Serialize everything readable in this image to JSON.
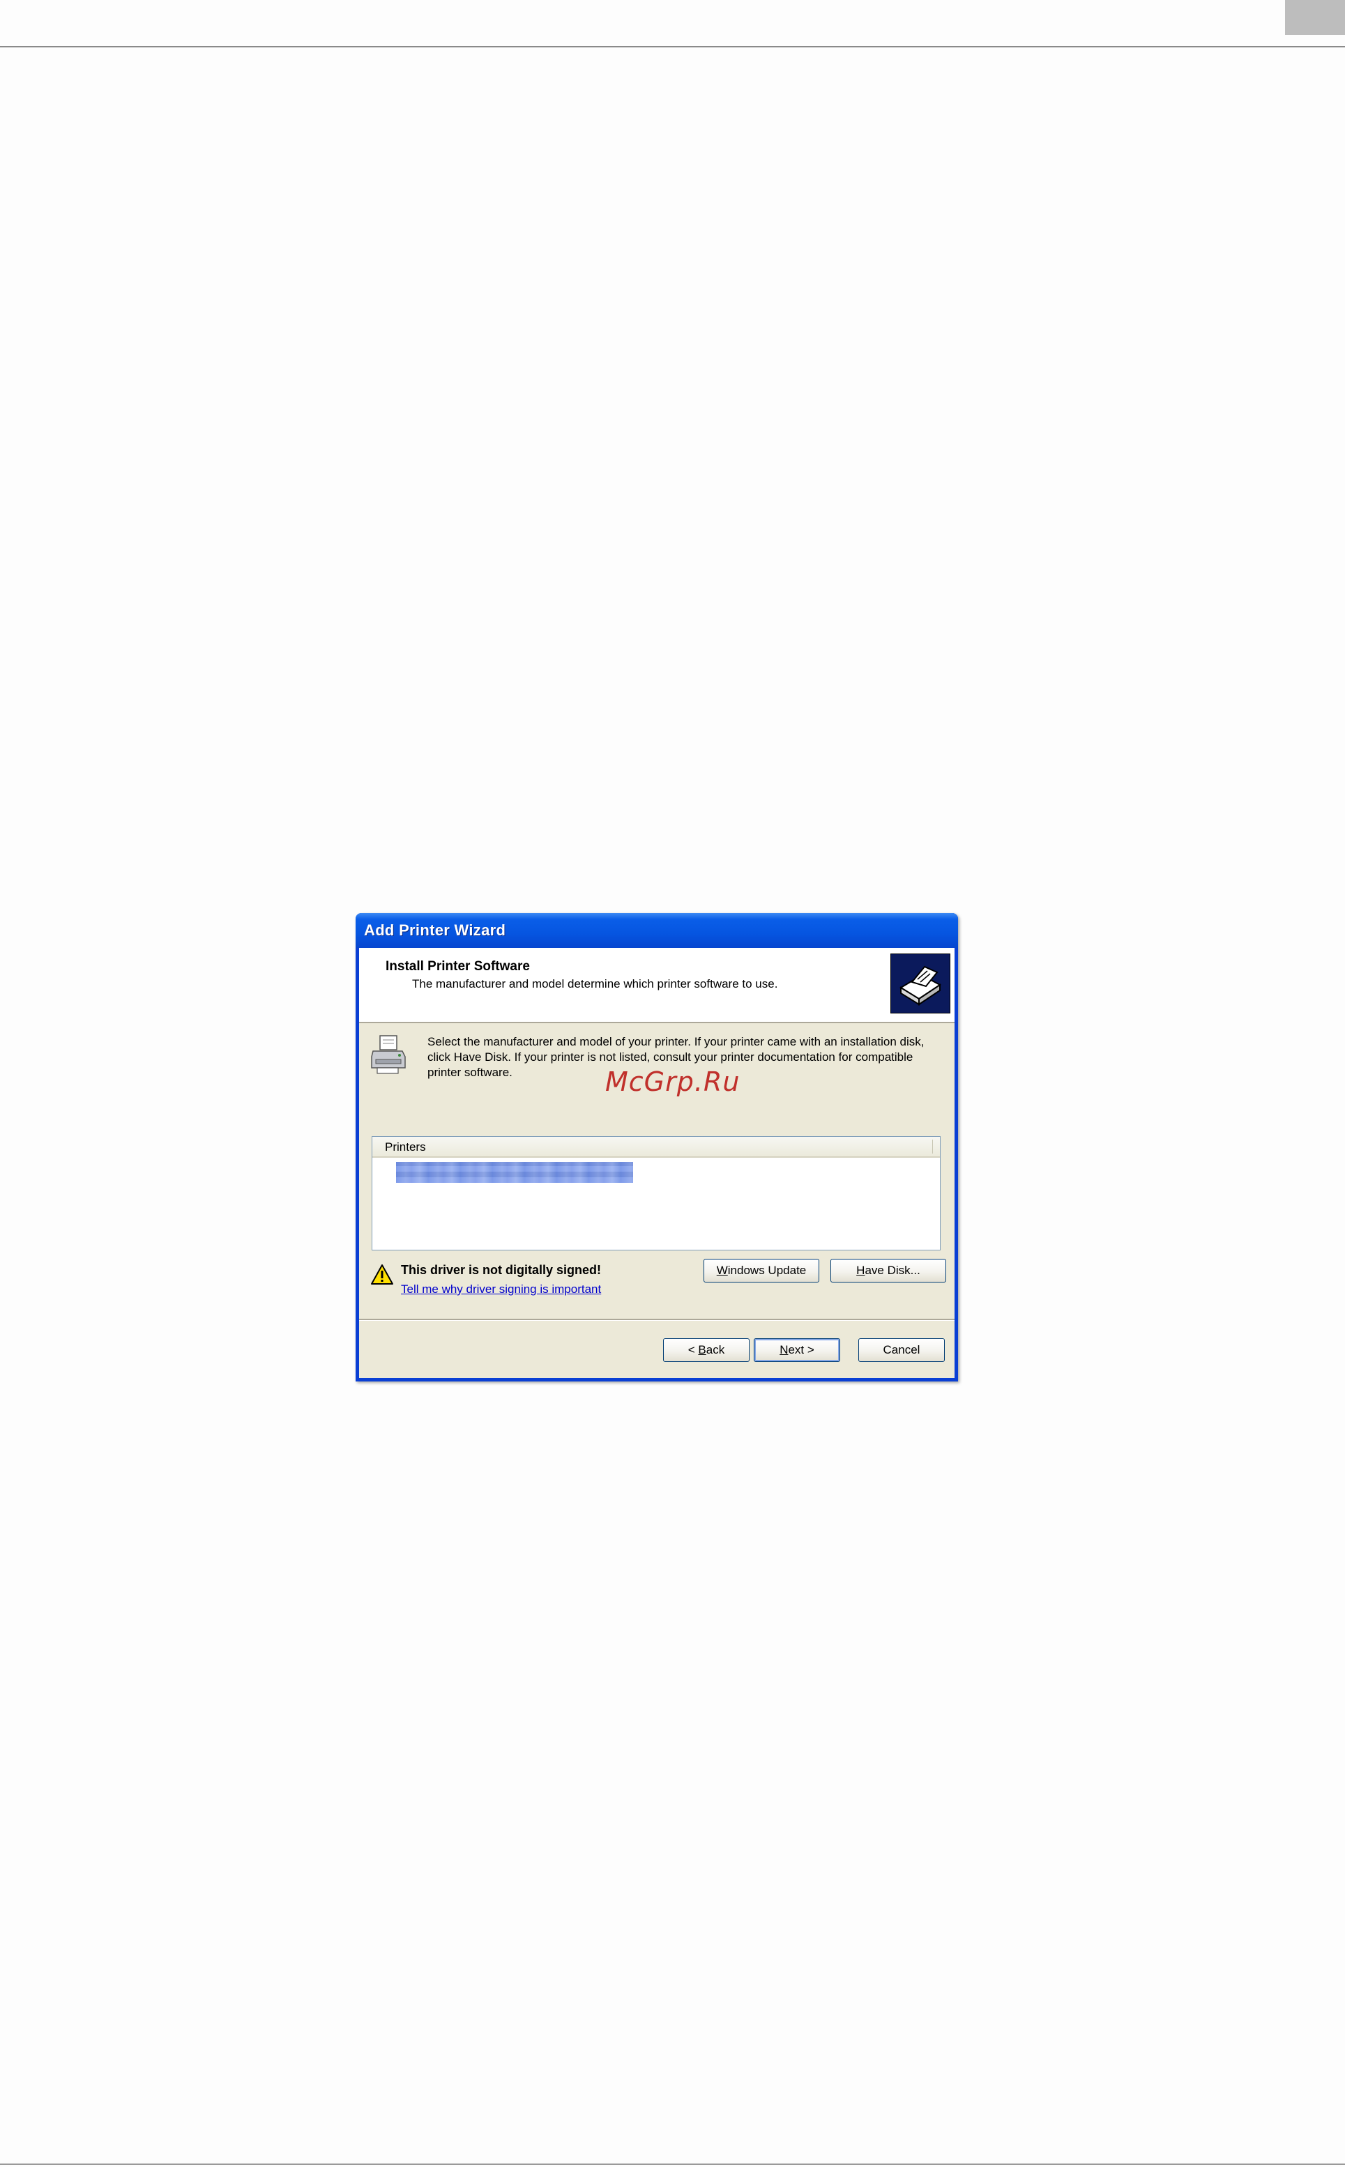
{
  "dialog": {
    "title": "Add Printer Wizard",
    "header": {
      "title": "Install Printer Software",
      "subtitle": "The manufacturer and model determine which printer software to use."
    },
    "instructions": "Select the manufacturer and model of your printer. If your printer came with an installation disk, click Have Disk. If your printer is not listed, consult your printer documentation for compatible printer software.",
    "printers_list": {
      "column_header": "Printers"
    },
    "warning": {
      "text": "This driver is not digitally signed!",
      "link": "Tell me why driver signing is important"
    },
    "buttons": {
      "windows_update": {
        "accel": "W",
        "rest": "indows Update"
      },
      "have_disk": {
        "accel": "H",
        "rest": "ave Disk..."
      },
      "back": {
        "prefix": "< ",
        "accel": "B",
        "rest": "ack"
      },
      "next": {
        "accel": "N",
        "rest": "ext >"
      },
      "cancel": "Cancel"
    }
  },
  "watermark": "McGrp.Ru"
}
